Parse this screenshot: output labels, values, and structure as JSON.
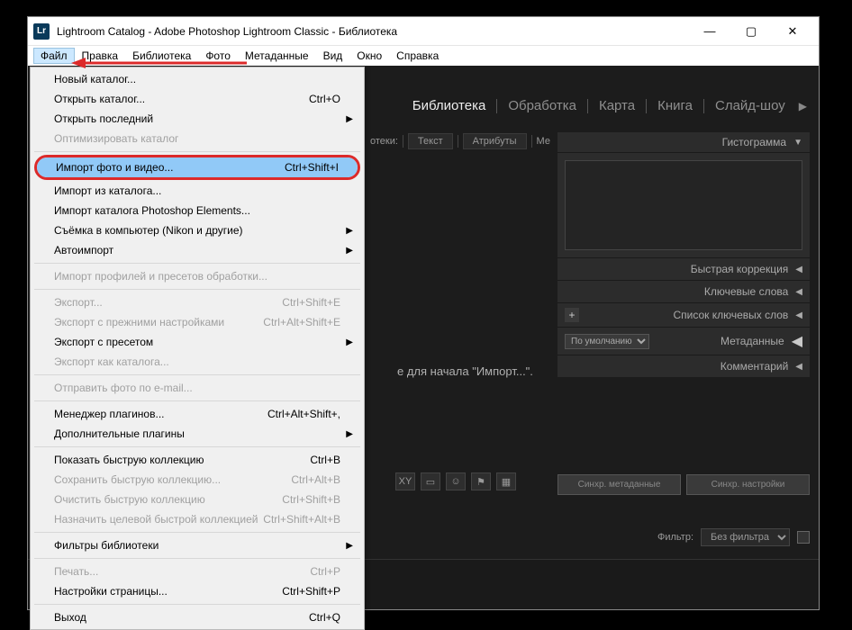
{
  "window": {
    "title": "Lightroom Catalog - Adobe Photoshop Lightroom Classic - Библиотека",
    "app_abbr": "Lr"
  },
  "menubar": {
    "items": [
      "Файл",
      "Правка",
      "Библиотека",
      "Фото",
      "Метаданные",
      "Вид",
      "Окно",
      "Справка"
    ]
  },
  "file_menu": {
    "new_catalog": "Новый каталог...",
    "open_catalog": "Открыть каталог...",
    "open_catalog_sc": "Ctrl+O",
    "open_recent": "Открыть последний",
    "optimize": "Оптимизировать каталог",
    "import": "Импорт фото и видео...",
    "import_sc": "Ctrl+Shift+I",
    "import_catalog": "Импорт из каталога...",
    "import_pse": "Импорт каталога Photoshop Elements...",
    "tether": "Съёмка в компьютер (Nikon и другие)",
    "autoimport": "Автоимпорт",
    "import_profiles": "Импорт профилей и пресетов обработки...",
    "export": "Экспорт...",
    "export_sc": "Ctrl+Shift+E",
    "export_prev": "Экспорт с прежними настройками",
    "export_prev_sc": "Ctrl+Alt+Shift+E",
    "export_preset": "Экспорт с пресетом",
    "export_catalog": "Экспорт как каталога...",
    "email": "Отправить фото по e-mail...",
    "plugin_mgr": "Менеджер плагинов...",
    "plugin_mgr_sc": "Ctrl+Alt+Shift+,",
    "extra_plugins": "Дополнительные плагины",
    "show_qc": "Показать быструю коллекцию",
    "show_qc_sc": "Ctrl+B",
    "save_qc": "Сохранить быструю коллекцию...",
    "save_qc_sc": "Ctrl+Alt+B",
    "clear_qc": "Очистить быструю коллекцию",
    "clear_qc_sc": "Ctrl+Shift+B",
    "target_qc": "Назначить целевой быстрой коллекцией",
    "target_qc_sc": "Ctrl+Shift+Alt+B",
    "lib_filters": "Фильтры библиотеки",
    "print": "Печать...",
    "print_sc": "Ctrl+P",
    "page_setup": "Настройки страницы...",
    "page_setup_sc": "Ctrl+Shift+P",
    "exit": "Выход",
    "exit_sc": "Ctrl+Q"
  },
  "modules": {
    "library": "Библиотека",
    "develop": "Обработка",
    "map": "Карта",
    "book": "Книга",
    "slideshow": "Слайд-шоу"
  },
  "filterbar": {
    "partial": "отеки:",
    "text": "Текст",
    "attrs": "Атрибуты",
    "meta_partial": "Ме"
  },
  "center": {
    "hint": "е для начала \"Импорт...\"."
  },
  "rightpanel": {
    "histogram": "Гистограмма",
    "quick": "Быстрая коррекция",
    "keywords": "Ключевые слова",
    "keylist": "Список ключевых слов",
    "metadata": "Метаданные",
    "metadata_preset": "По умолчанию",
    "comments": "Комментарий"
  },
  "sync": {
    "meta": "Синхр. метаданные",
    "settings": "Синхр. настройки"
  },
  "bottomfilter": {
    "label": "Фильтр:",
    "value": "Без фильтра"
  },
  "toolbar_icons": [
    "XY",
    "▭",
    "☺",
    "⚑",
    "▦"
  ]
}
